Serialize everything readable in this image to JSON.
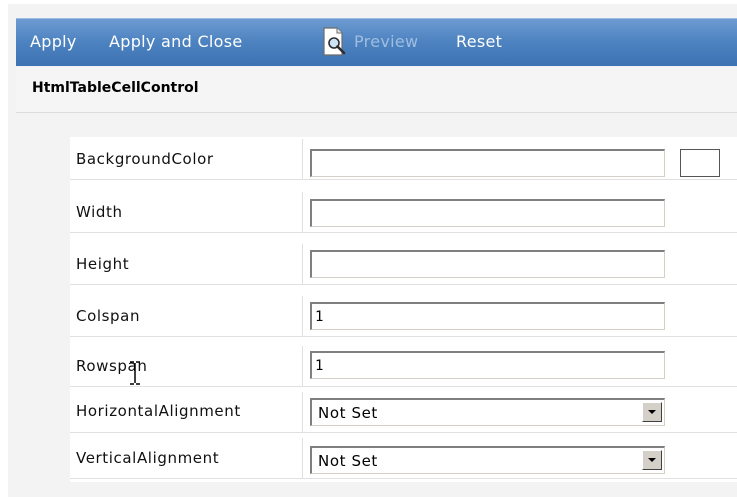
{
  "toolbar": {
    "apply_label": "Apply",
    "apply_close_label": "Apply and Close",
    "preview_label": "Preview",
    "reset_label": "Reset",
    "preview_icon": "magnifier-page-icon"
  },
  "control_title": "HtmlTableCellControl",
  "properties": [
    {
      "label": "BackgroundColor",
      "type": "text-color",
      "value": ""
    },
    {
      "label": "Width",
      "type": "text",
      "value": ""
    },
    {
      "label": "Height",
      "type": "text",
      "value": ""
    },
    {
      "label": "Colspan",
      "type": "text",
      "value": "1"
    },
    {
      "label": "Rowspan",
      "type": "text",
      "value": "1"
    },
    {
      "label": "HorizontalAlignment",
      "type": "select",
      "value": "Not Set"
    },
    {
      "label": "VerticalAlignment",
      "type": "select",
      "value": "Not Set"
    }
  ],
  "colors": {
    "toolbar_top": "#6d9bd0",
    "toolbar_bottom": "#3d72b3",
    "toolbar_text": "#ffffff",
    "toolbar_disabled_text": "#9fbde0"
  }
}
